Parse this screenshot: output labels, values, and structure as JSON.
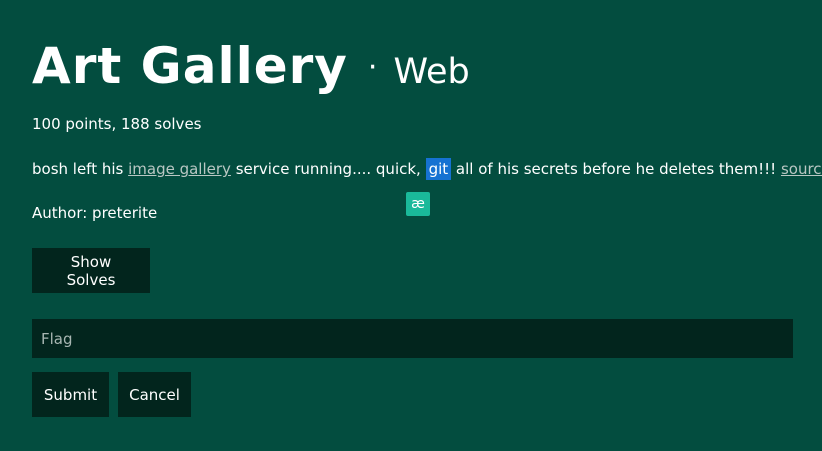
{
  "challenge": {
    "title": "Art Gallery",
    "separator": "·",
    "category": "Web",
    "meta": "100 points, 188 solves",
    "description": {
      "part1": "bosh left his ",
      "link_gallery": "image gallery",
      "part2": " service running.... quick, ",
      "highlight": "git",
      "part3": " all of his secrets before he deletes them!!! ",
      "link_source": "source"
    },
    "author": "Author: preterite"
  },
  "extension_icon": {
    "icon": "ae-icon",
    "glyph": "æ"
  },
  "actions": {
    "show_solves": "Show Solves",
    "flag_placeholder": "Flag",
    "submit": "Submit",
    "cancel": "Cancel"
  },
  "colors": {
    "background": "#034d3f",
    "button_bg": "#02251d",
    "highlight": "#1672d2",
    "ae_icon": "#1ab99a"
  }
}
